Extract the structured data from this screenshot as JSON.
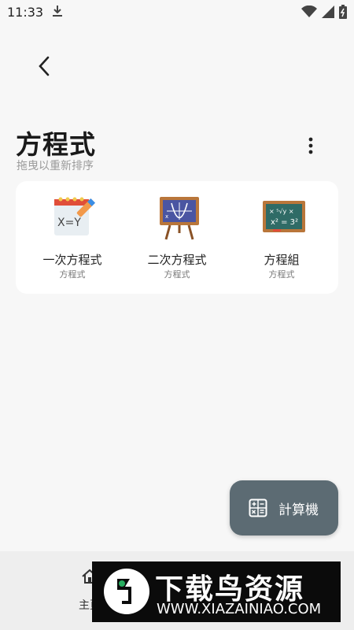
{
  "status": {
    "time": "11:33"
  },
  "header": {
    "title": "方程式",
    "subtitle": "拖曳以重新排序"
  },
  "items": [
    {
      "label": "一次方程式",
      "sub": "方程式",
      "icon": "linear-equation-notepad-icon",
      "thumb_text": "X=Y"
    },
    {
      "label": "二次方程式",
      "sub": "方程式",
      "icon": "quadratic-easel-graph-icon"
    },
    {
      "label": "方程組",
      "sub": "方程式",
      "icon": "equation-system-chalkboard-icon",
      "thumb_text": "x² = 3²"
    }
  ],
  "fab": {
    "label": "計算機",
    "icon": "calculator-icon"
  },
  "nav": {
    "home_label": "主頁"
  },
  "watermark": {
    "name": "下载鸟资源",
    "url": "WWW.XIAZAINIAO.COM"
  },
  "colors": {
    "fab": "#5c6b73",
    "background": "#f7f7f7",
    "card": "#ffffff"
  }
}
